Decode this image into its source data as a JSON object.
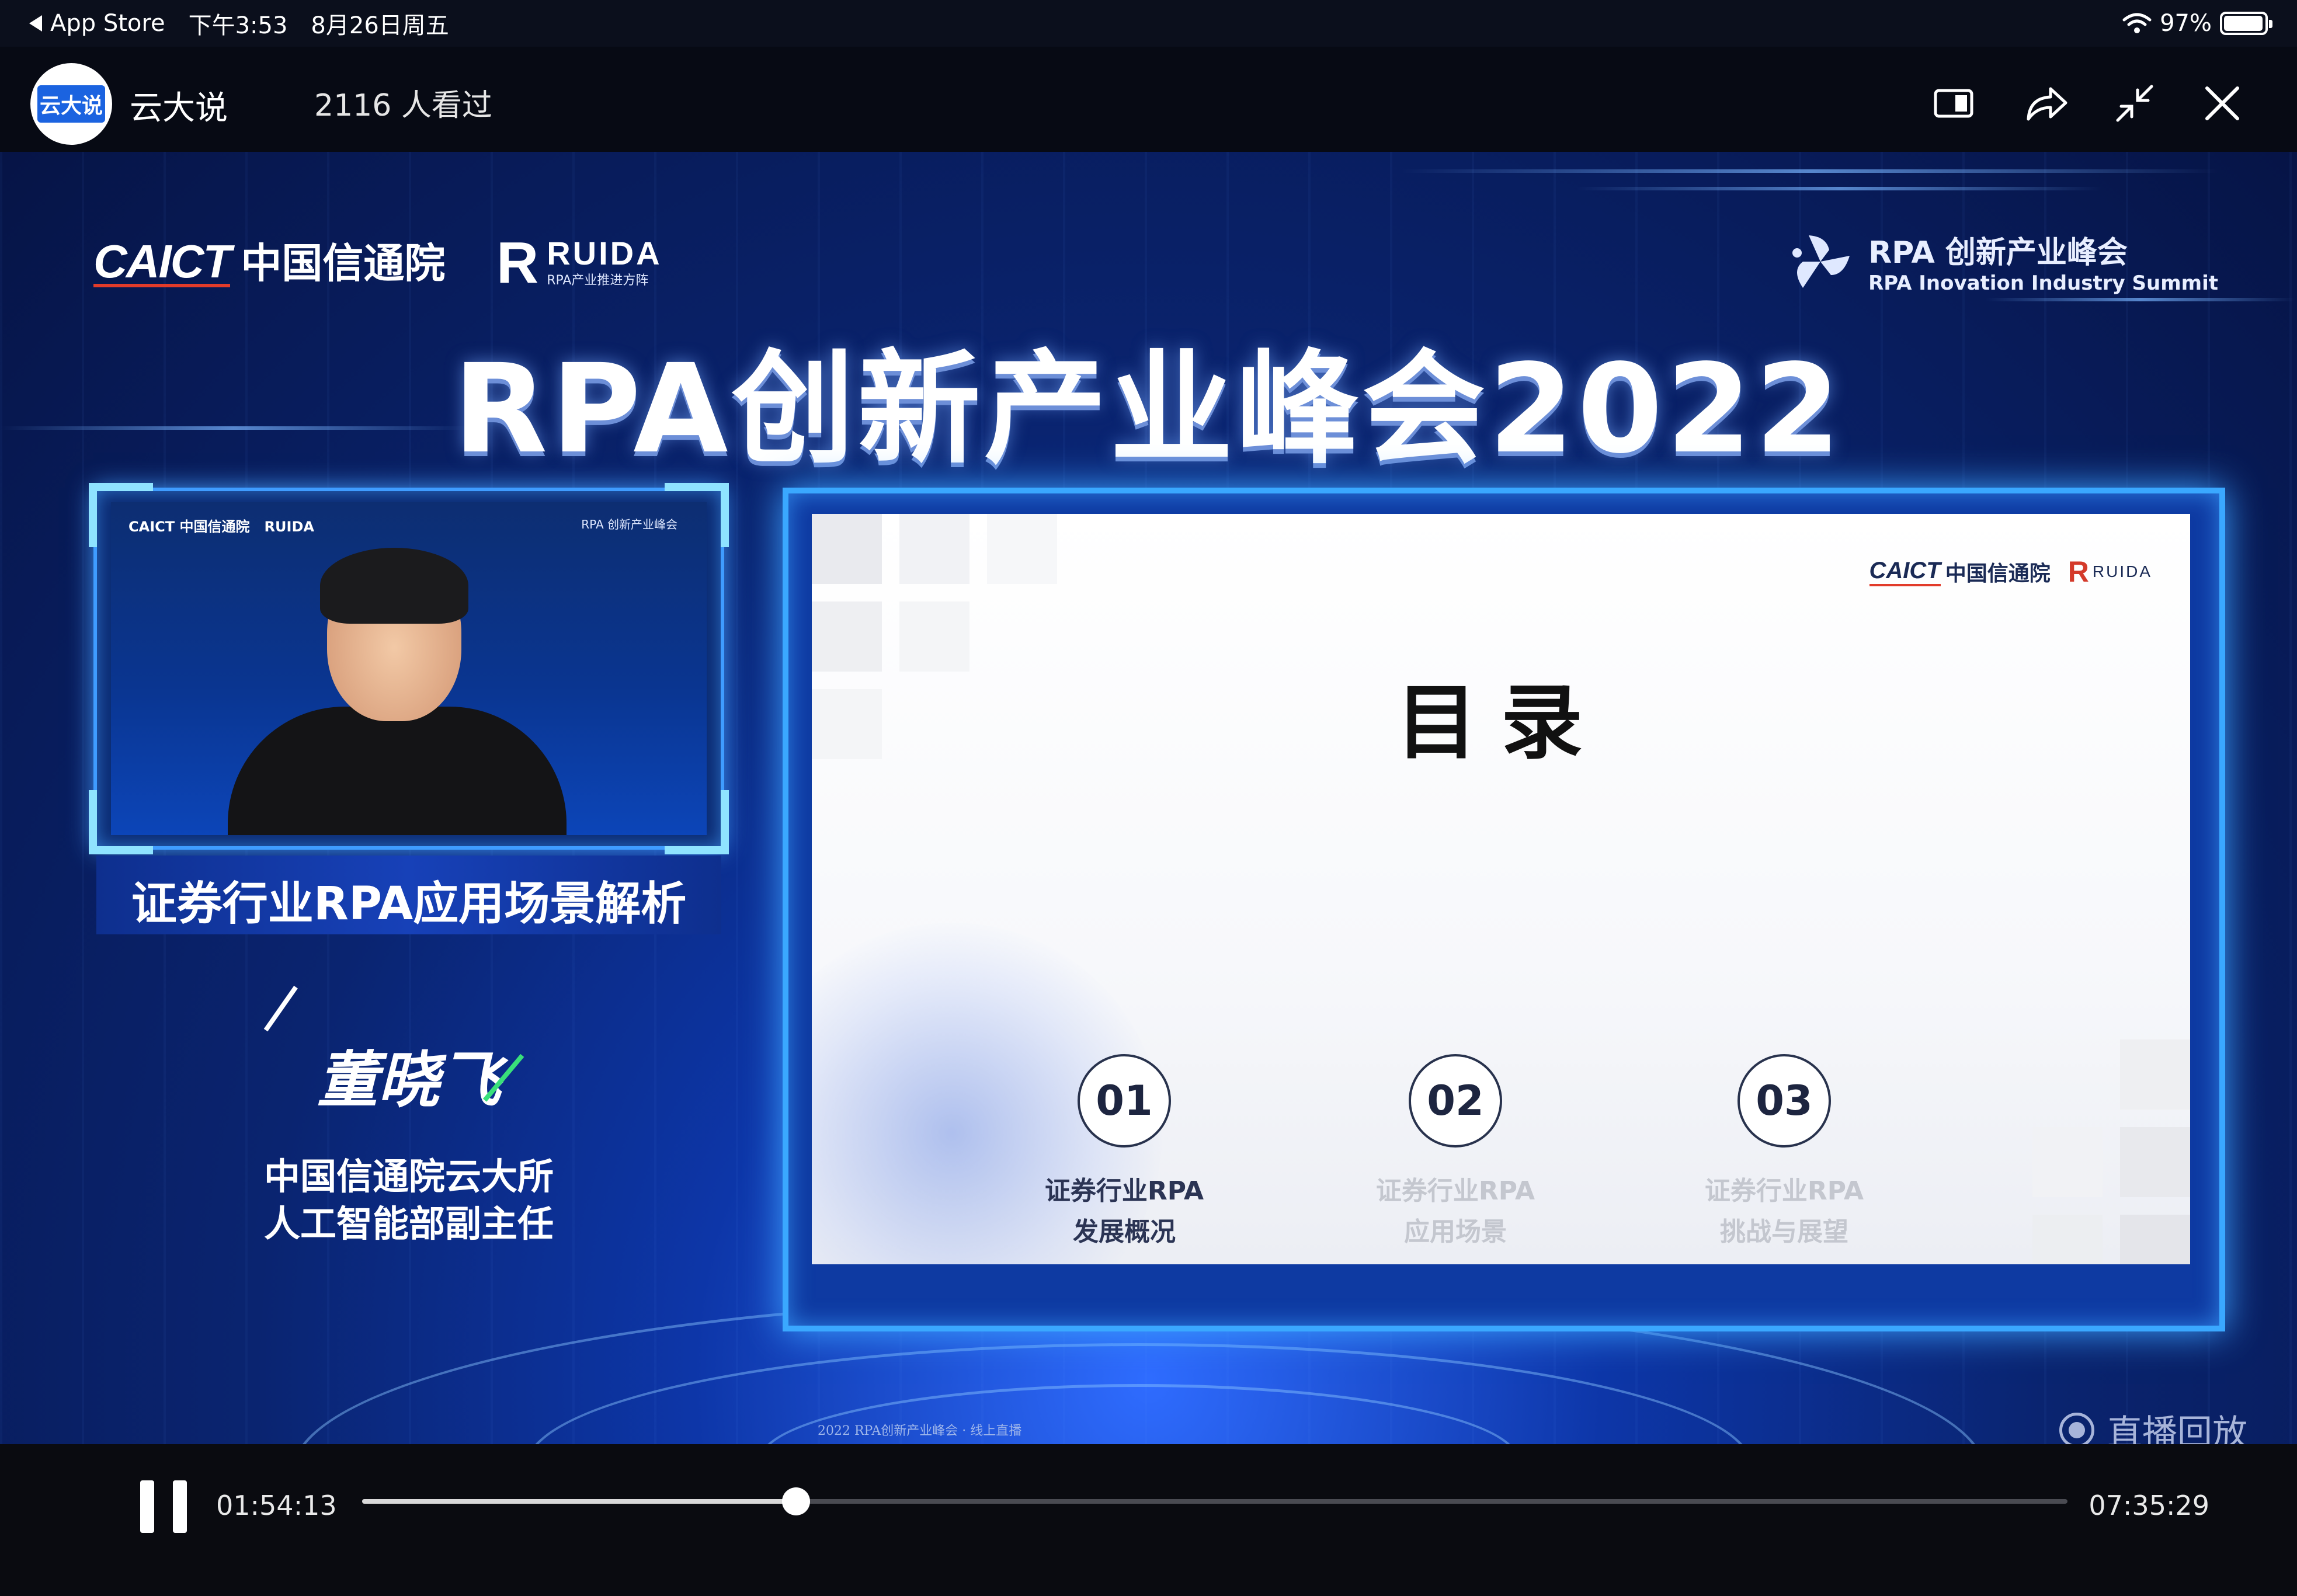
{
  "status_bar": {
    "back_app": "App Store",
    "time": "下午3:53",
    "date": "8月26日周五",
    "battery": "97%",
    "battery_level": 0.97
  },
  "top_bar": {
    "avatar_text": "云大说",
    "channel_name": "云大说",
    "view_count": "2116 人看过",
    "icons": [
      "picture-in-picture-icon",
      "share-icon",
      "minimize-icon",
      "close-icon"
    ]
  },
  "video": {
    "caict_en": "CAICT",
    "caict_cn": "中国信通院",
    "ruida_en": "RUIDA",
    "ruida_cn": "RPA产业推进方阵",
    "summit_cn": "RPA 创新产业峰会",
    "summit_en": "RPA Inovation Industry Summit",
    "main_title": "RPA创新产业峰会2022",
    "speaker_caption": "证券行业RPA应用场景解析",
    "speaker_name": "董晓飞",
    "speaker_org_line1": "中国信通院云大所",
    "speaker_org_line2": "人工智能部副主任",
    "slide": {
      "logo_caict_en": "CAICT",
      "logo_caict_cn": "中国信通院",
      "logo_ruida_en": "RUIDA",
      "title": "目录",
      "items": [
        {
          "num": "01",
          "line1": "证券行业RPA",
          "line2": "发展概况",
          "active": true
        },
        {
          "num": "02",
          "line1": "证券行业RPA",
          "line2": "应用场景",
          "active": false
        },
        {
          "num": "03",
          "line1": "证券行业RPA",
          "line2": "挑战与展望",
          "active": false
        }
      ]
    },
    "slide_footer": "2022 RPA创新产业峰会 · 线上直播",
    "replay_label": "直播回放"
  },
  "player": {
    "current_time": "01:54:13",
    "total_time": "07:35:29",
    "progress": 0.2546
  },
  "colors": {
    "accent_blue": "#3aa8ff",
    "caict_red": "#e23b2a",
    "name_green": "#39e07a"
  }
}
